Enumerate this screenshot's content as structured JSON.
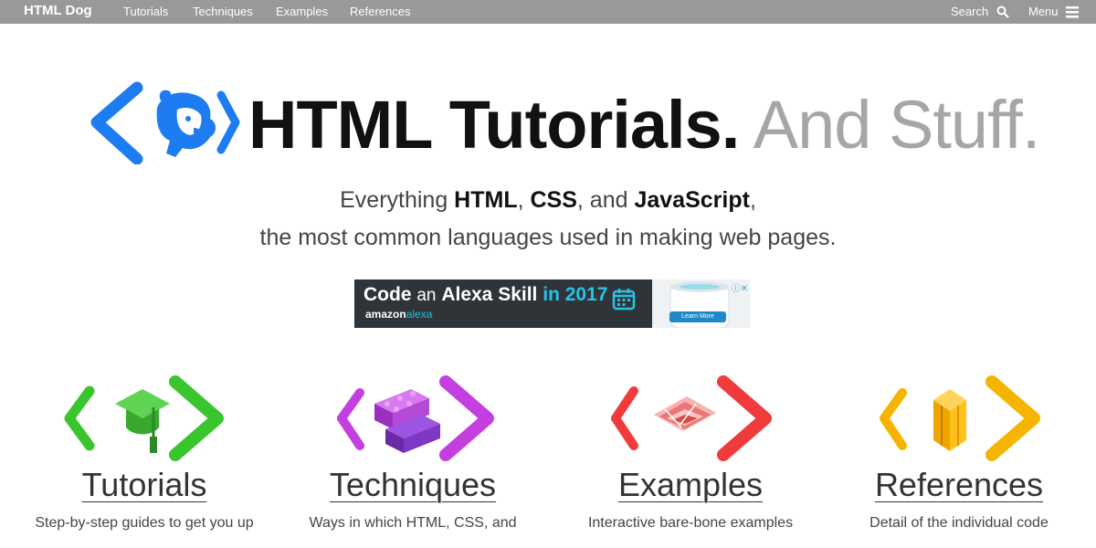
{
  "topbar": {
    "brand": "HTML Dog",
    "nav": [
      "Tutorials",
      "Techniques",
      "Examples",
      "References"
    ],
    "search_label": "Search",
    "menu_label": "Menu"
  },
  "hero": {
    "title_strong": "HTML Tutorials.",
    "title_light": "And Stuff.",
    "tagline_pre": "Everything ",
    "tagline_html": "HTML",
    "tagline_sep1": ", ",
    "tagline_css": "CSS",
    "tagline_sep2": ", and ",
    "tagline_js": "JavaScript",
    "tagline_post": ",",
    "tagline_line2": "the most common languages used in making web pages."
  },
  "ad": {
    "word1": "Code",
    "word2": "an",
    "word3": "Alexa Skill",
    "word4": "in 2017",
    "brand1": "amazon",
    "brand2": "alexa",
    "cta": "Learn More"
  },
  "sections": [
    {
      "title": "Tutorials",
      "desc": "Step-by-step guides to get you up",
      "color": "#39c52d"
    },
    {
      "title": "Techniques",
      "desc": "Ways in which HTML, CSS, and",
      "color": "#c43fe0"
    },
    {
      "title": "Examples",
      "desc": "Interactive bare-bone examples",
      "color": "#ef3b3b"
    },
    {
      "title": "References",
      "desc": "Detail of the individual code",
      "color": "#f5b400"
    }
  ]
}
